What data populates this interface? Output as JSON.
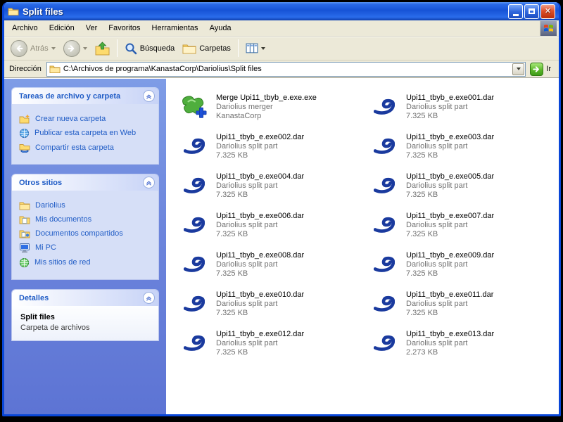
{
  "window": {
    "title": "Split files"
  },
  "menubar": {
    "items": [
      "Archivo",
      "Edición",
      "Ver",
      "Favoritos",
      "Herramientas",
      "Ayuda"
    ]
  },
  "toolbar": {
    "back": "Atrás",
    "search": "Búsqueda",
    "folders": "Carpetas"
  },
  "address": {
    "label": "Dirección",
    "path": "C:\\Archivos de programa\\KanastaCorp\\Dariolius\\Split files",
    "go": "Ir"
  },
  "sidebar": {
    "tasks": {
      "title": "Tareas de archivo y carpeta",
      "items": [
        "Crear nueva carpeta",
        "Publicar esta carpeta en Web",
        "Compartir esta carpeta"
      ]
    },
    "places": {
      "title": "Otros sitios",
      "items": [
        "Dariolius",
        "Mis documentos",
        "Documentos compartidos",
        "Mi PC",
        "Mis sitios de red"
      ]
    },
    "details": {
      "title": "Detalles",
      "name": "Split files",
      "type": "Carpeta de archivos"
    }
  },
  "files": [
    {
      "name": "Merge Upi11_tbyb_e.exe.exe",
      "desc": "Dariolius merger",
      "info": "KanastaCorp",
      "icon": "merge"
    },
    {
      "name": "Upi11_tbyb_e.exe001.dar",
      "desc": "Dariolius split part",
      "info": "7.325 KB",
      "icon": "dar"
    },
    {
      "name": "Upi11_tbyb_e.exe002.dar",
      "desc": "Dariolius split part",
      "info": "7.325 KB",
      "icon": "dar"
    },
    {
      "name": "Upi11_tbyb_e.exe003.dar",
      "desc": "Dariolius split part",
      "info": "7.325 KB",
      "icon": "dar"
    },
    {
      "name": "Upi11_tbyb_e.exe004.dar",
      "desc": "Dariolius split part",
      "info": "7.325 KB",
      "icon": "dar"
    },
    {
      "name": "Upi11_tbyb_e.exe005.dar",
      "desc": "Dariolius split part",
      "info": "7.325 KB",
      "icon": "dar"
    },
    {
      "name": "Upi11_tbyb_e.exe006.dar",
      "desc": "Dariolius split part",
      "info": "7.325 KB",
      "icon": "dar"
    },
    {
      "name": "Upi11_tbyb_e.exe007.dar",
      "desc": "Dariolius split part",
      "info": "7.325 KB",
      "icon": "dar"
    },
    {
      "name": "Upi11_tbyb_e.exe008.dar",
      "desc": "Dariolius split part",
      "info": "7.325 KB",
      "icon": "dar"
    },
    {
      "name": "Upi11_tbyb_e.exe009.dar",
      "desc": "Dariolius split part",
      "info": "7.325 KB",
      "icon": "dar"
    },
    {
      "name": "Upi11_tbyb_e.exe010.dar",
      "desc": "Dariolius split part",
      "info": "7.325 KB",
      "icon": "dar"
    },
    {
      "name": "Upi11_tbyb_e.exe011.dar",
      "desc": "Dariolius split part",
      "info": "7.325 KB",
      "icon": "dar"
    },
    {
      "name": "Upi11_tbyb_e.exe012.dar",
      "desc": "Dariolius split part",
      "info": "7.325 KB",
      "icon": "dar"
    },
    {
      "name": "Upi11_tbyb_e.exe013.dar",
      "desc": "Dariolius split part",
      "info": "2.273 KB",
      "icon": "dar"
    }
  ]
}
